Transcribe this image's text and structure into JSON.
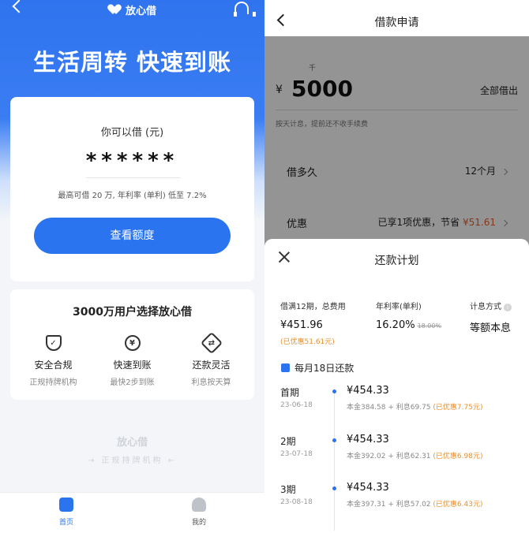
{
  "left": {
    "brand": "放心借",
    "slogan": "生活周转 快速到账",
    "card": {
      "title": "你可以借 (元)",
      "masked_amount": "******",
      "subtitle": "最高可借 20 万, 年利率 (单利) 低至 7.2%",
      "button": "查看额度"
    },
    "features": {
      "title": "3000万用户选择放心借",
      "items": [
        {
          "icon": "shield-check-icon",
          "name": "安全合规",
          "desc": "正规持牌机构"
        },
        {
          "icon": "yen-coin-icon",
          "name": "快速到账",
          "desc": "最快2步到账"
        },
        {
          "icon": "swap-icon",
          "name": "还款灵活",
          "desc": "利息按天算"
        }
      ]
    },
    "watermark": {
      "brand": "放心借",
      "tagline": "正规持牌机构"
    },
    "tabs": [
      {
        "icon": "home-icon",
        "label": "首页",
        "active": true
      },
      {
        "icon": "user-icon",
        "label": "我的",
        "active": false
      }
    ]
  },
  "right": {
    "title": "借款申请",
    "amount": {
      "unit_hint": "千",
      "currency": "¥",
      "value": "5000",
      "borrow_all": "全部借出",
      "note": "按天计息，提前还不收手续费"
    },
    "duration": {
      "label": "借多久",
      "value": "12个月"
    },
    "discount": {
      "label": "优惠",
      "text": "已享1项优惠，节省",
      "amount": "¥51.61"
    },
    "plan": {
      "title": "还款计划",
      "total": {
        "label": "借满12期，总费用",
        "value": "¥451.96",
        "discount": "(已优惠51.61元)"
      },
      "rate": {
        "label": "年利率(单利)",
        "value": "16.20%",
        "original": "18.00%"
      },
      "method": {
        "label": "计息方式",
        "value": "等额本息"
      },
      "due_day": "每月18日还款",
      "installments": [
        {
          "name": "首期",
          "date": "23-06-18",
          "amount": "¥454.33",
          "detail": "本金384.58 + 利息69.75",
          "saved": "(已优惠7.75元)"
        },
        {
          "name": "2期",
          "date": "23-07-18",
          "amount": "¥454.33",
          "detail": "本金392.02 + 利息62.31",
          "saved": "(已优惠6.98元)"
        },
        {
          "name": "3期",
          "date": "23-08-18",
          "amount": "¥454.33",
          "detail": "本金397.31 + 利息57.02",
          "saved": "(已优惠6.43元)"
        }
      ]
    }
  },
  "colors": {
    "primary": "#2b74f0",
    "orange": "#e8902c",
    "discount_red": "#e8602c"
  }
}
